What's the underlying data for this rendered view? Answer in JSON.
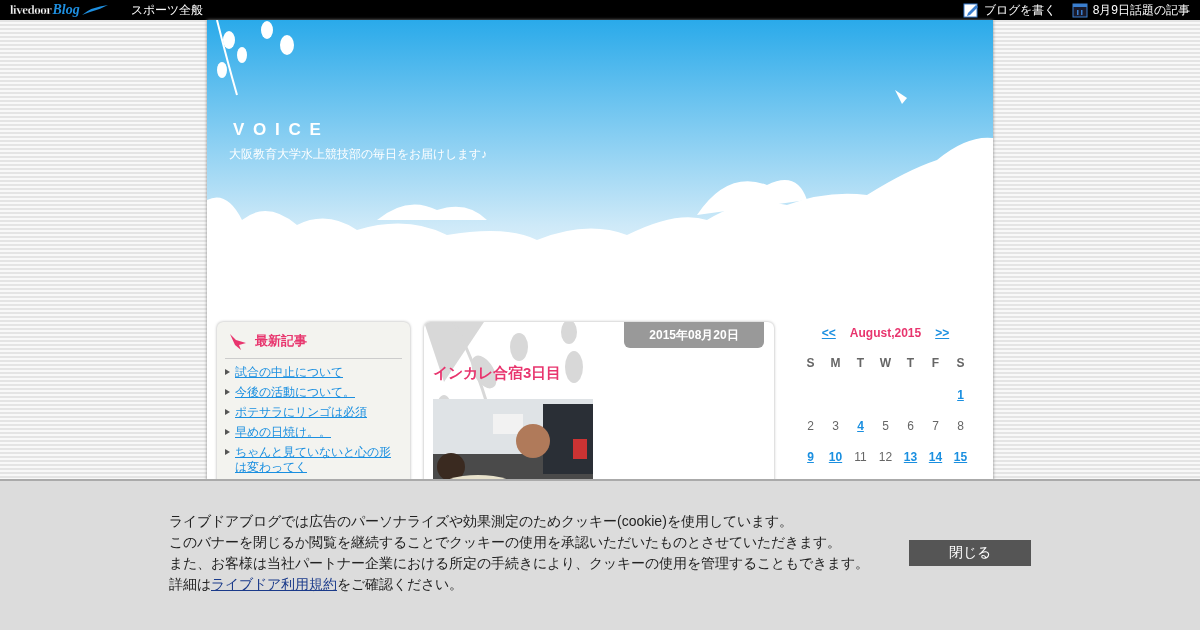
{
  "topbar": {
    "logo": {
      "word": "livedoor",
      "script": "Blog"
    },
    "category": "スポーツ全般",
    "links": [
      {
        "kind": "write",
        "label": "ブログを書く"
      },
      {
        "kind": "calendar",
        "label": "8月9日話題の記事"
      }
    ]
  },
  "header": {
    "title": "V O I C E",
    "tagline": "大阪教育大学水上競技部の毎日をお届けします♪"
  },
  "sidebar": {
    "heading": "最新記事",
    "items": [
      "試合の中止について",
      "今後の活動について。",
      "ポテサラにリンゴは必須",
      "早めの日焼け。。",
      "ちゃんと見ていないと心の形は変わってく"
    ]
  },
  "entry": {
    "date": "2015年08月20日",
    "title": "インカレ合宿3日目"
  },
  "calendar": {
    "prev": "<<",
    "month": "August,2015",
    "next": ">>",
    "weekdays": [
      "S",
      "M",
      "T",
      "W",
      "T",
      "F",
      "S"
    ],
    "weeks": [
      [
        {
          "day": "1",
          "linked": true
        }
      ],
      [
        {
          "day": "2",
          "linked": false
        },
        {
          "day": "3",
          "linked": false
        },
        {
          "day": "4",
          "linked": true
        },
        {
          "day": "5",
          "linked": false
        },
        {
          "day": "6",
          "linked": false
        },
        {
          "day": "7",
          "linked": false
        },
        {
          "day": "8",
          "linked": false
        }
      ],
      [
        {
          "day": "9",
          "linked": true
        },
        {
          "day": "10",
          "linked": true
        },
        {
          "day": "11",
          "linked": false
        },
        {
          "day": "12",
          "linked": false
        },
        {
          "day": "13",
          "linked": true
        },
        {
          "day": "14",
          "linked": true
        },
        {
          "day": "15",
          "linked": true
        }
      ]
    ]
  },
  "cookie_banner": {
    "lines": [
      "ライブドアブログでは広告のパーソナライズや効果測定のためクッキー(cookie)を使用しています。",
      "このバナーを閉じるか閲覧を継続することでクッキーの使用を承認いただいたものとさせていただきます。",
      "また、お客様は当社パートナー企業における所定の手続きにより、クッキーの使用を管理することもできます。"
    ],
    "detail": {
      "before": "詳細は",
      "link": "ライブドア利用規約",
      "after": "をご確認ください。"
    },
    "button": "閉じる"
  }
}
